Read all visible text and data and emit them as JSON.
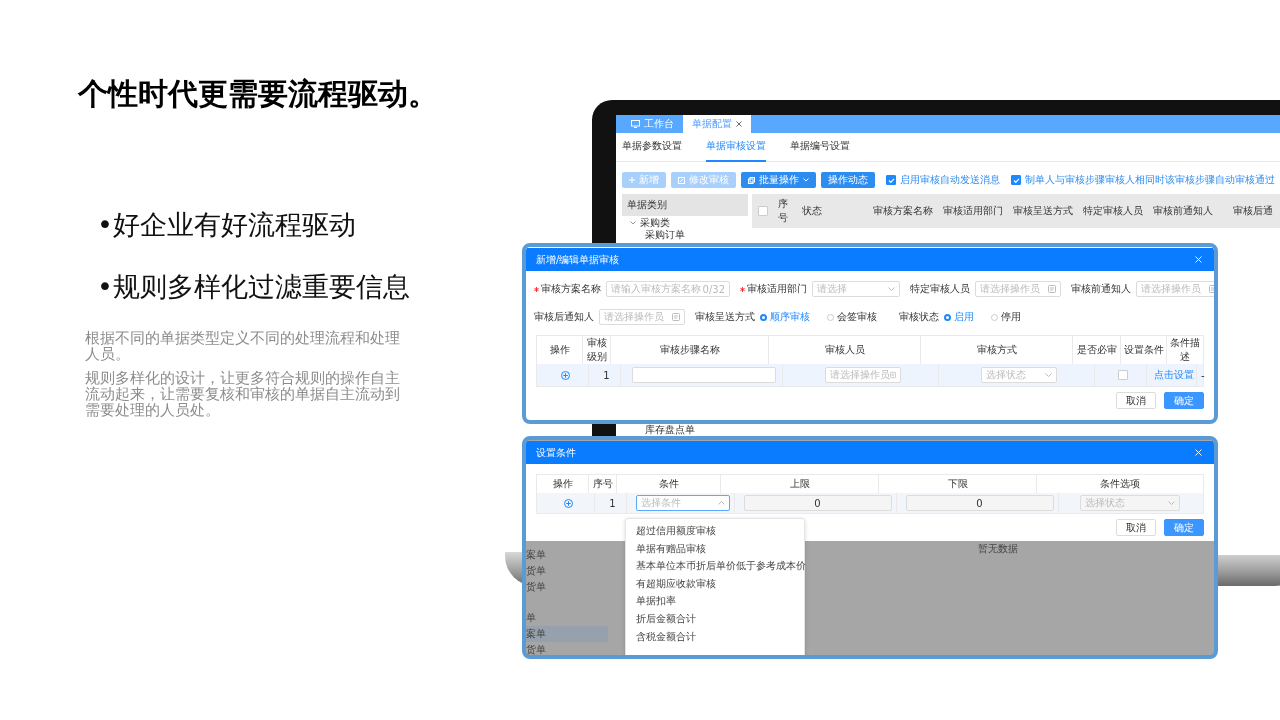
{
  "slide": {
    "title": "个性时代更需要流程驱动。",
    "bullets": [
      "•好企业有好流程驱动",
      "•规则多样化过滤重要信息"
    ],
    "paragraphs": [
      "根据不同的单据类型定义不同的处理流程和处理人员。",
      "规则多样化的设计，让更多符合规则的操作自主流动起来，让需要复核和审核的单据自主流动到需要处理的人员处。"
    ]
  },
  "app": {
    "tabs": [
      {
        "label": "工作台",
        "selected": false,
        "kind": "home"
      },
      {
        "label": "单据配置",
        "selected": true,
        "kind": "closable"
      }
    ],
    "subtabs": [
      {
        "label": "单据参数设置",
        "selected": false
      },
      {
        "label": "单据审核设置",
        "selected": true
      },
      {
        "label": "单据编号设置",
        "selected": false
      }
    ],
    "toolbar": [
      {
        "label": "新增",
        "disabled": true,
        "kind": "add"
      },
      {
        "label": "修改审核",
        "disabled": true,
        "kind": "edit"
      },
      {
        "label": "批量操作",
        "disabled": false,
        "kind": "menu"
      },
      {
        "label": "操作动态",
        "disabled": false,
        "kind": "plain"
      }
    ],
    "options": [
      {
        "label": "启用审核自动发送消息",
        "checked": true
      },
      {
        "label": "制单人与审核步骤审核人相同时该审核步骤自动审核通过",
        "checked": true
      }
    ],
    "category_panel": {
      "title": "单据类别",
      "tree": [
        {
          "label": "采购类",
          "expanded": true,
          "children": [
            {
              "label": "采购订单"
            }
          ]
        }
      ],
      "tree_tail": [
        "库存盘点单"
      ]
    },
    "table": {
      "select_all": false,
      "columns": [
        "序号",
        "状态",
        "审核方案名称",
        "审核适用部门",
        "审核呈送方式",
        "特定审核人员",
        "审核前通知人",
        "审核后通"
      ]
    }
  },
  "dialog_audit": {
    "title": "新增/编辑单据审核",
    "form_rows": [
      {
        "fields": [
          {
            "label": "审核方案名称",
            "required": true,
            "kind": "text",
            "placeholder": "请输入审核方案名称",
            "counter": "0/32"
          },
          {
            "label": "审核适用部门",
            "required": true,
            "kind": "select",
            "placeholder": "请选择"
          },
          {
            "label": "特定审核人员",
            "required": false,
            "kind": "picker",
            "placeholder": "请选择操作员"
          },
          {
            "label": "审核前通知人",
            "required": false,
            "kind": "picker",
            "placeholder": "请选择操作员"
          }
        ]
      },
      {
        "fields": [
          {
            "label": "审核后通知人",
            "required": false,
            "kind": "picker",
            "placeholder": "请选择操作员"
          },
          {
            "label": "审核呈送方式",
            "required": false,
            "kind": "radio",
            "options": [
              {
                "label": "顺序审核",
                "selected": true
              },
              {
                "label": "会签审核",
                "selected": false
              }
            ]
          },
          {
            "label": "审核状态",
            "required": false,
            "kind": "radio",
            "options": [
              {
                "label": "启用",
                "selected": true
              },
              {
                "label": "停用",
                "selected": false
              }
            ]
          }
        ]
      }
    ],
    "columns": [
      "操作",
      "审核级别",
      "审核步骤名称",
      "审核人员",
      "审核方式",
      "是否必审",
      "设置条件",
      "条件描述"
    ],
    "row": {
      "level": "1",
      "reviewer_placeholder": "请选择操作员",
      "method_placeholder": "选择状态",
      "required_check": false,
      "link": "点击设置",
      "description": "-"
    },
    "buttons": [
      {
        "label": "取消",
        "kind": "default"
      },
      {
        "label": "确定",
        "kind": "primary"
      }
    ]
  },
  "dialog_condition": {
    "title": "设置条件",
    "columns": [
      "操作",
      "序号",
      "条件",
      "上限",
      "下限",
      "条件选项"
    ],
    "row": {
      "index": "1",
      "condition_placeholder": "选择条件",
      "upper": "0",
      "lower": "0",
      "option_placeholder": "选择状态"
    },
    "buttons": [
      {
        "label": "取消",
        "kind": "default"
      },
      {
        "label": "确定",
        "kind": "primary"
      }
    ],
    "dropdown": [
      "超过信用额度审核",
      "单据有赠品审核",
      "基本单位本币折后单价低于参考成本价",
      "有超期应收款审核",
      "单据扣率",
      "折后金额合计",
      "含税金额合计"
    ],
    "background": {
      "items_top": [
        "案单",
        "货单",
        "货单"
      ],
      "items_bottom": [
        {
          "label": "单",
          "selected": false
        },
        {
          "label": "案单",
          "selected": true
        },
        {
          "label": "货单",
          "selected": false
        }
      ],
      "empty_text": "暂无数据"
    }
  }
}
